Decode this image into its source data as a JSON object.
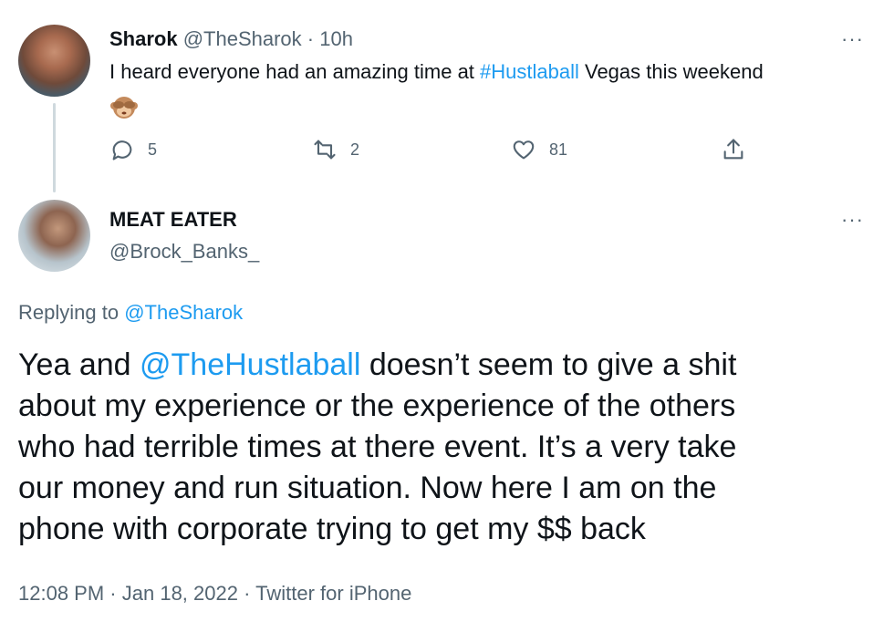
{
  "tweet": {
    "author_name": "Sharok",
    "author_handle": "@TheSharok",
    "separator": "·",
    "time": "10h",
    "text_before": "I heard everyone had an amazing time at ",
    "hashtag": "#Hustlaball",
    "text_after": " Vegas this weekend",
    "emoji": "see-no-evil-monkey",
    "actions": {
      "replies": "5",
      "retweets": "2",
      "likes": "81"
    }
  },
  "reply": {
    "author_name": "MEAT EATER",
    "author_handle": "@Brock_Banks_",
    "replying_label": "Replying to",
    "replying_handle": "@TheSharok",
    "body_lines": [
      {
        "before": "Yea and ",
        "mention": "@TheHustlaball",
        "after": " doesn’t seem to give a shit"
      },
      {
        "text": "about my experience or the experience of the others"
      },
      {
        "text": "who had terrible times at there event. It’s a very take"
      },
      {
        "text": "our money and run situation. Now here I am on the"
      },
      {
        "text": "phone with corporate trying to get my $$ back"
      }
    ],
    "time": "12:08 PM",
    "date": "Jan 18, 2022",
    "source": "Twitter for iPhone",
    "separator": "·"
  },
  "more_label": "···",
  "colors": {
    "link": "#1d9bf0",
    "secondary_text": "#536471",
    "primary_text": "#0f1419",
    "thread_line": "#cfd9de"
  },
  "icons": [
    "reply-icon",
    "retweet-icon",
    "like-icon",
    "share-icon",
    "more-icon"
  ]
}
